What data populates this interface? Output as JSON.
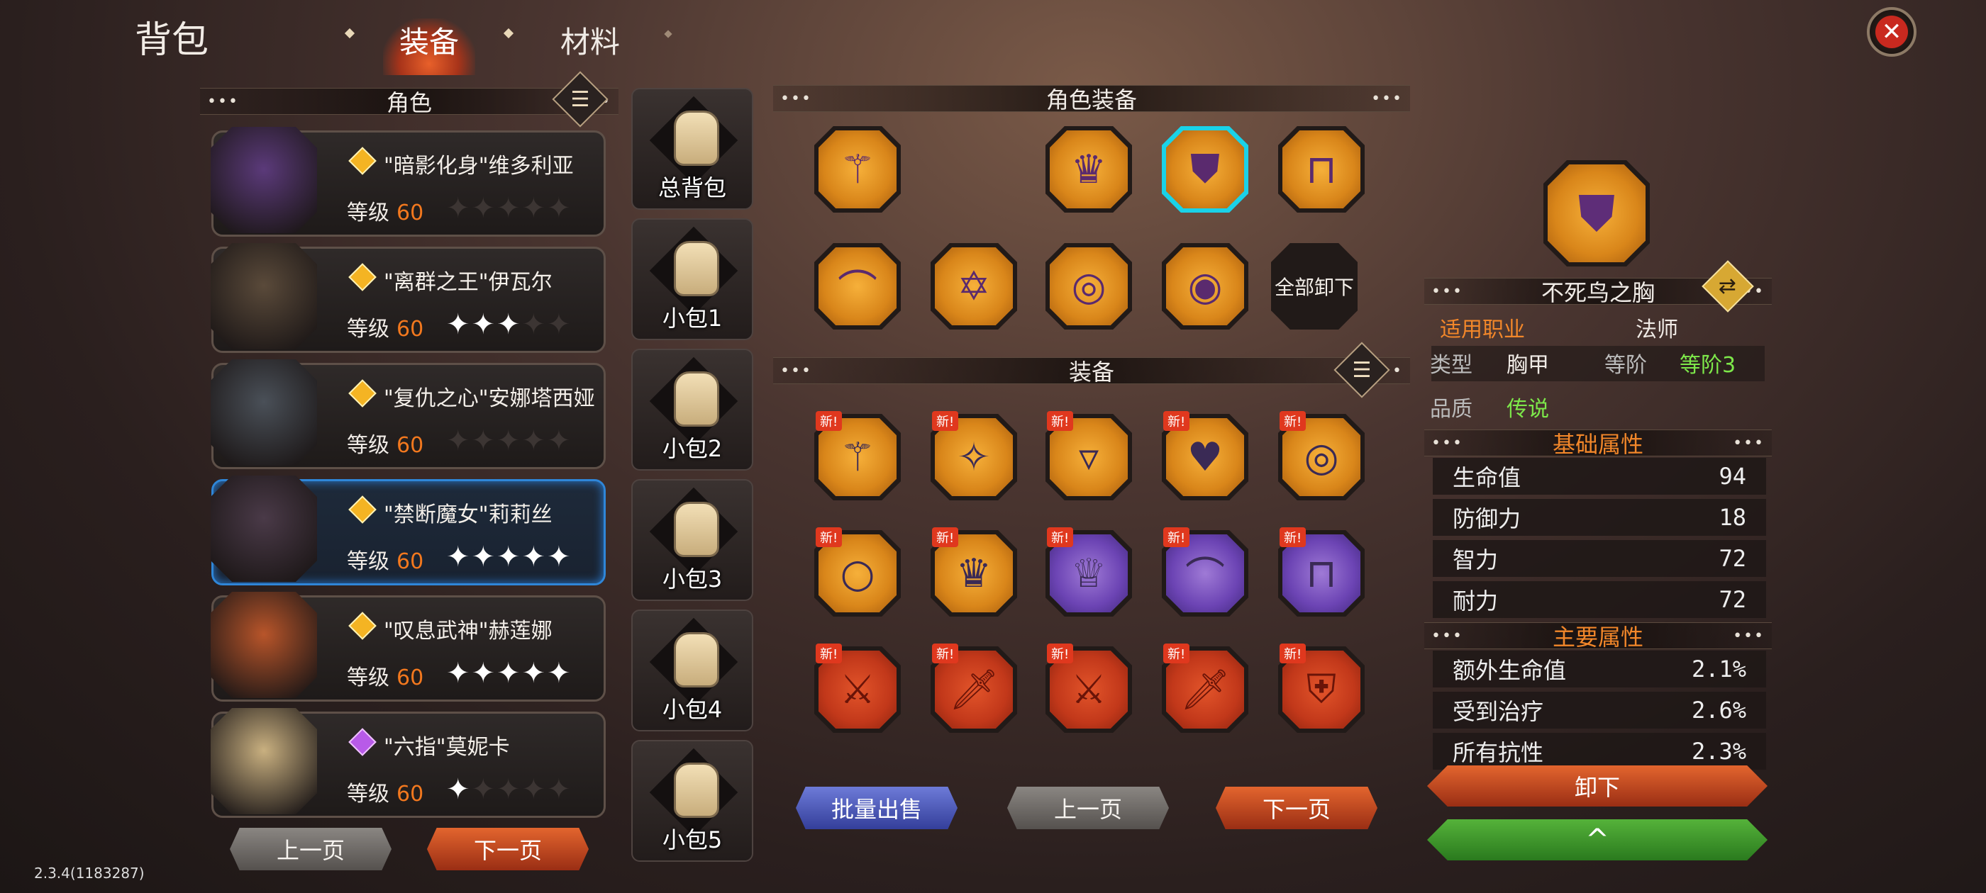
{
  "header": {
    "title": "背包",
    "tabs": [
      "装备",
      "材料"
    ],
    "active_tab": 0
  },
  "roles": {
    "section_title": "角色",
    "characters": [
      {
        "name": "\"暗影化身\"维多利亚",
        "level_label": "等级",
        "level": "60",
        "stars": 0,
        "gem": "gold"
      },
      {
        "name": "\"离群之王\"伊瓦尔",
        "level_label": "等级",
        "level": "60",
        "stars": 3,
        "gem": "gold"
      },
      {
        "name": "\"复仇之心\"安娜塔西娅",
        "level_label": "等级",
        "level": "60",
        "stars": 0,
        "gem": "gold"
      },
      {
        "name": "\"禁断魔女\"莉莉丝",
        "level_label": "等级",
        "level": "60",
        "stars": 5,
        "gem": "gold",
        "selected": true
      },
      {
        "name": "\"叹息武神\"赫莲娜",
        "level_label": "等级",
        "level": "60",
        "stars": 5,
        "gem": "gold"
      },
      {
        "name": "\"六指\"莫妮卡",
        "level_label": "等级",
        "level": "60",
        "stars": 1,
        "gem": "purple"
      }
    ],
    "prev_label": "上一页",
    "next_label": "下一页"
  },
  "bags": [
    "总背包",
    "小包1",
    "小包2",
    "小包3",
    "小包4",
    "小包5"
  ],
  "character_equipment": {
    "title": "角色装备",
    "unequip_all_label": "全部卸下",
    "slots": [
      {
        "icon": "staff-icon",
        "glyph": "⚚",
        "rarity": "orange"
      },
      {
        "icon": "crown-icon",
        "glyph": "♛",
        "rarity": "orange"
      },
      {
        "icon": "chest-armor-icon",
        "glyph": "⛊",
        "rarity": "orange",
        "selected": true
      },
      {
        "icon": "pants-icon",
        "glyph": "⊓",
        "rarity": "orange"
      },
      {
        "icon": "boots-icon",
        "glyph": "⌒",
        "rarity": "orange"
      },
      {
        "icon": "hexagram-icon",
        "glyph": "✡",
        "rarity": "orange"
      },
      {
        "icon": "ring-icon",
        "glyph": "◎",
        "rarity": "orange"
      },
      {
        "icon": "ring-icon",
        "glyph": "◉",
        "rarity": "orange"
      }
    ]
  },
  "equipment": {
    "title": "装备",
    "new_tag": "新!",
    "items": [
      {
        "icon": "staff-icon",
        "glyph": "⚚",
        "rarity": "orange"
      },
      {
        "icon": "wand-icon",
        "glyph": "✧",
        "rarity": "orange"
      },
      {
        "icon": "necklace-icon",
        "glyph": "▿",
        "rarity": "orange"
      },
      {
        "icon": "amulet-icon",
        "glyph": "♥",
        "rarity": "orange"
      },
      {
        "icon": "ring-icon",
        "glyph": "◎",
        "rarity": "orange"
      },
      {
        "icon": "ring-icon",
        "glyph": "○",
        "rarity": "orange"
      },
      {
        "icon": "crown-icon",
        "glyph": "♛",
        "rarity": "orange"
      },
      {
        "icon": "helmet-icon",
        "glyph": "♕",
        "rarity": "purple"
      },
      {
        "icon": "boots-icon",
        "glyph": "⌒",
        "rarity": "purple"
      },
      {
        "icon": "pants-icon",
        "glyph": "⊓",
        "rarity": "purple"
      },
      {
        "icon": "greatsword-icon",
        "glyph": "⚔",
        "rarity": "red"
      },
      {
        "icon": "sword-icon",
        "glyph": "🗡",
        "rarity": "red"
      },
      {
        "icon": "blade-icon",
        "glyph": "⚔",
        "rarity": "red"
      },
      {
        "icon": "dagger-icon",
        "glyph": "🗡",
        "rarity": "red"
      },
      {
        "icon": "shield-icon",
        "glyph": "⛨",
        "rarity": "red"
      }
    ],
    "batch_sell_label": "批量出售",
    "prev_label": "上一页",
    "next_label": "下一页"
  },
  "detail": {
    "item_name": "不死鸟之胸",
    "class_label": "适用职业",
    "class_value": "法师",
    "type_label": "类型",
    "type_value": "胸甲",
    "tier_label": "等阶",
    "tier_value": "等阶3",
    "quality_label": "品质",
    "quality_value": "传说",
    "base_title": "基础属性",
    "base_attrs": [
      {
        "name": "生命值",
        "value": "94"
      },
      {
        "name": "防御力",
        "value": "18"
      },
      {
        "name": "智力",
        "value": "72"
      },
      {
        "name": "耐力",
        "value": "72"
      }
    ],
    "main_title": "主要属性",
    "main_attrs": [
      {
        "name": "额外生命值",
        "value": "2.1%"
      },
      {
        "name": "受到治疗",
        "value": "2.6%"
      },
      {
        "name": "所有抗性",
        "value": "2.3%"
      }
    ],
    "unequip_label": "卸下",
    "upgrade_icon": "^"
  },
  "version": "2.3.4(1183287)",
  "colors": {
    "accent_orange": "#f2781e",
    "select_blue": "#2f86d8",
    "legend_orange": "#d9861a",
    "epic_purple": "#6c44b4",
    "green": "#7de84a"
  }
}
